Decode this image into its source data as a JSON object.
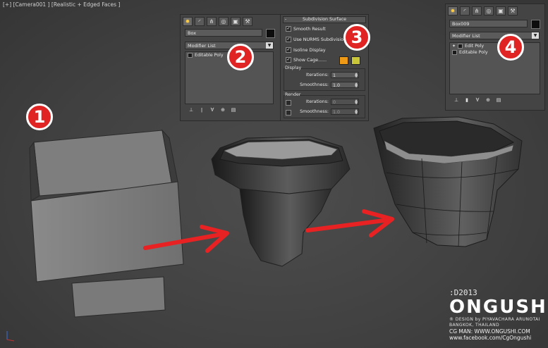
{
  "viewport": {
    "label": "[+] [Camera001 ] [Realistic + Edged Faces ]",
    "badges": [
      "1",
      "2",
      "3",
      "4"
    ]
  },
  "icons": {
    "tabs": [
      "sun-create-icon",
      "modify-curve-icon",
      "hierarchy-icon",
      "motion-icon",
      "display-icon",
      "utilities-hammer-icon"
    ],
    "stack_buttons": [
      "pin-stack-icon",
      "show-end-result-icon",
      "make-unique-icon",
      "remove-modifier-icon",
      "configure-modifier-sets-icon"
    ]
  },
  "panel_a": {
    "object_name": "Box",
    "modifier_list": "Modifier List",
    "stack": [
      "Editable Poly"
    ]
  },
  "panel_b": {
    "title": "Subdivision Surface",
    "smooth_result": "Smooth Result",
    "use_nurms": "Use NURMS Subdivision",
    "isoline": "Isoline Display",
    "show_cage": "Show Cage......",
    "cage_colors": [
      "#ee9a16",
      "#c9c63a"
    ],
    "display_label": "Display",
    "render_label": "Render",
    "iterations_label": "Iterations:",
    "smoothness_label": "Smoothness:",
    "display_iterations": "1",
    "display_smoothness": "1.0",
    "render_iterations": "0",
    "render_smoothness": "1.0"
  },
  "panel_c": {
    "object_name": "Box009",
    "modifier_list": "Modifier List",
    "stack": [
      "Edit Poly",
      "Editable Poly"
    ]
  },
  "logo": {
    "date": ":D2013",
    "brand": "ONGUSHI",
    "credit": "® DESIGN by PIYAVACHARA ARUNOTAI",
    "city": "BANGKOK, THAILAND",
    "site": "CG MAN: WWW.ONGUSHI.COM",
    "facebook": "www.facebook.com/CgOngushi"
  },
  "colors": {
    "badge": "#e02424",
    "arrow": "#e82222"
  }
}
